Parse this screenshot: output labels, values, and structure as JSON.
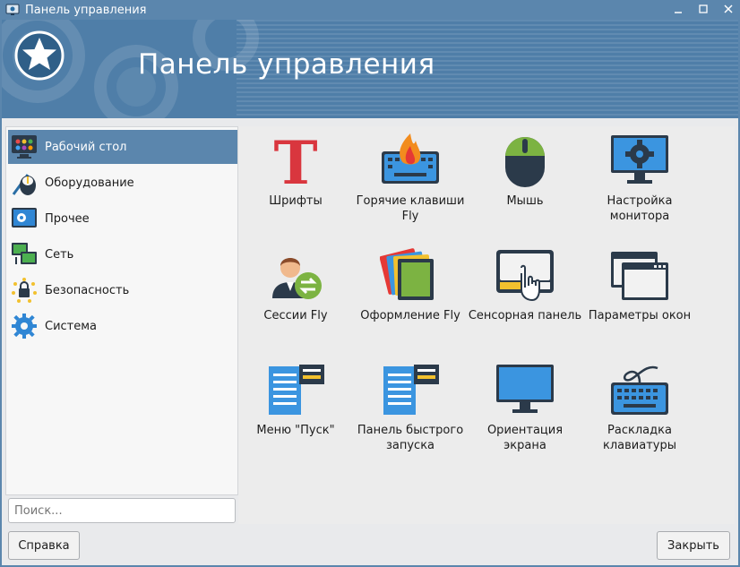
{
  "window": {
    "title": "Панель управления",
    "icon": "monitor-gear-icon",
    "controls": [
      "minimize-icon",
      "maximize-icon",
      "close-icon"
    ]
  },
  "banner": {
    "title": "Панель управления"
  },
  "sidebar": {
    "items": [
      {
        "label": "Рабочий стол",
        "icon": "desktop-icon",
        "active": true
      },
      {
        "label": "Оборудование",
        "icon": "hardware-icon",
        "active": false
      },
      {
        "label": "Прочее",
        "icon": "other-icon",
        "active": false
      },
      {
        "label": "Сеть",
        "icon": "network-icon",
        "active": false
      },
      {
        "label": "Безопасность",
        "icon": "security-icon",
        "active": false
      },
      {
        "label": "Система",
        "icon": "system-gear-icon",
        "active": false
      }
    ]
  },
  "tiles": [
    {
      "label": "Шрифты",
      "icon": "fonts-icon"
    },
    {
      "label": "Горячие клавиши Fly",
      "icon": "hotkeys-icon"
    },
    {
      "label": "Мышь",
      "icon": "mouse-icon"
    },
    {
      "label": "Настройка монитора",
      "icon": "monitor-settings-icon"
    },
    {
      "label": "Сессии Fly",
      "icon": "sessions-icon"
    },
    {
      "label": "Оформление Fly",
      "icon": "themes-icon"
    },
    {
      "label": "Сенсорная панель",
      "icon": "touchpad-icon"
    },
    {
      "label": "Параметры окон",
      "icon": "window-params-icon"
    },
    {
      "label": "Меню \"Пуск\"",
      "icon": "start-menu-icon"
    },
    {
      "label": "Панель быстрого запуска",
      "icon": "quick-launch-icon"
    },
    {
      "label": "Ориентация экрана",
      "icon": "screen-orientation-icon"
    },
    {
      "label": "Раскладка клавиатуры",
      "icon": "keyboard-layout-icon"
    }
  ],
  "search": {
    "placeholder": "Поиск..."
  },
  "footer": {
    "help_label": "Справка",
    "close_label": "Закрыть"
  },
  "colors": {
    "accent": "#5b86ad",
    "banner": "#4f7ea8"
  }
}
